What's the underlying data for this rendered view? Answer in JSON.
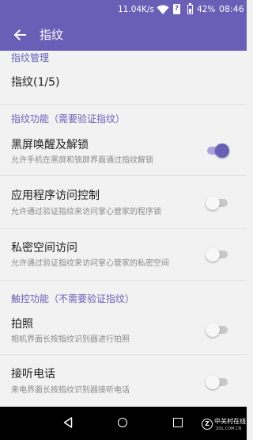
{
  "status_bar": {
    "speed": "11.04K/s",
    "sim": "?",
    "battery": "42%",
    "time": "08:46"
  },
  "app_bar": {
    "title": "指纹"
  },
  "sections": {
    "manage": "指纹管理",
    "verify": "指纹功能（需要验证指纹）",
    "touch": "触控功能（不需要验证指纹）"
  },
  "items": {
    "fingerprints": {
      "title": "指纹(1/5)"
    },
    "wake": {
      "title": "黑屏唤醒及解锁",
      "subtitle": "允许手机在黑屏和锁屏界面通过指纹解锁",
      "enabled": true
    },
    "app_lock": {
      "title": "应用程序访问控制",
      "subtitle": "允许通过验证指纹来访问掌心管家的程序锁",
      "enabled": false
    },
    "private_space": {
      "title": "私密空间访问",
      "subtitle": "允许通过验证指纹来访问掌心管家的私密空间",
      "enabled": false
    },
    "camera": {
      "title": "拍照",
      "subtitle": "相机界面长按指纹识别器进行拍照",
      "enabled": false
    },
    "answer_call": {
      "title": "接听电话",
      "subtitle": "来电界面长按指纹识别器接听电话",
      "enabled": false
    }
  },
  "watermark": {
    "text": "中关村在线",
    "sub": "ZOL.COM.CN",
    "logo": "Z"
  },
  "colors": {
    "primary": "#6a5fb7",
    "toggle_on_track": "#aaa2de",
    "toggle_off_track": "#c8c8c8"
  }
}
